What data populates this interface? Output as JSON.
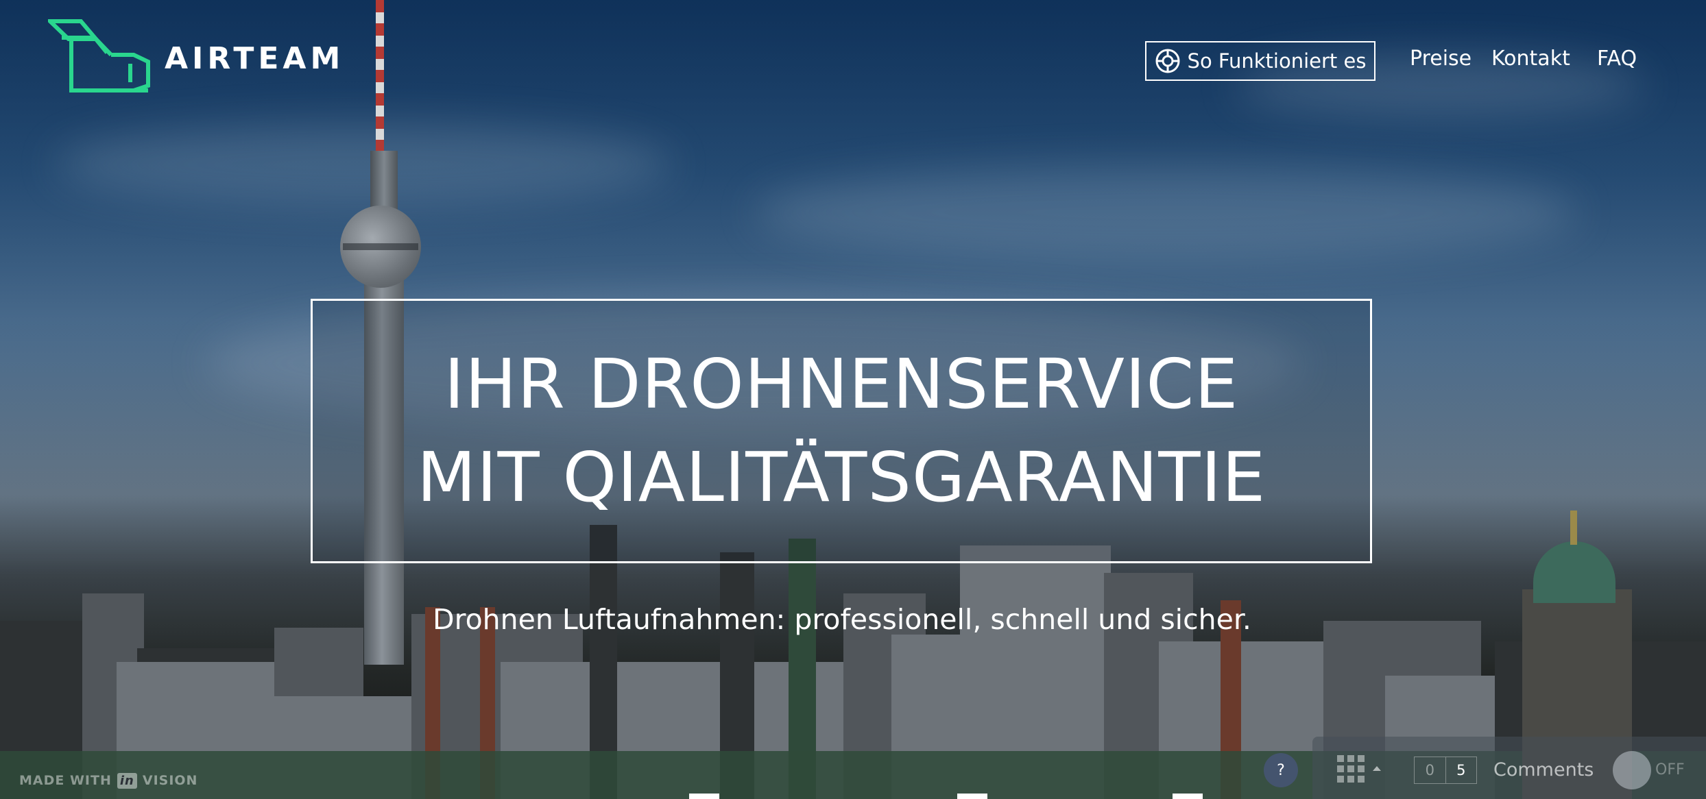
{
  "brand": {
    "name": "AIRTEAM",
    "logo_icon": "drone-logo-icon",
    "logo_color": "#2ad68e"
  },
  "nav": {
    "how_it_works": {
      "label": "So Funktioniert es",
      "icon": "lifebuoy-icon"
    },
    "links": [
      "Preise",
      "Kontakt",
      "FAQ"
    ]
  },
  "hero": {
    "headline_lines": [
      "IHR DROHNENSERVICE",
      "MIT QIALITÄTSGARANTIE"
    ],
    "subline": "Drohnen Luftaufnahmen: professionell, schnell und sicher."
  },
  "invision": {
    "made_with": "MADE WITH",
    "brand_in": "in",
    "brand_rest": "VISION",
    "help": "?",
    "comments_unread": "0",
    "comments_total": "5",
    "comments_label": "Comments",
    "toggle_label": "OFF"
  }
}
